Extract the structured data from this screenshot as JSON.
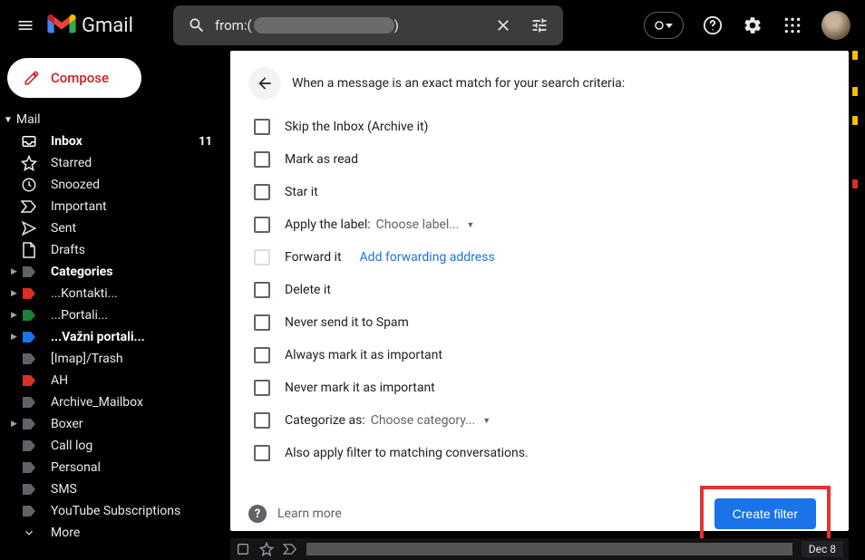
{
  "app": {
    "name": "Gmail"
  },
  "search": {
    "prefix": "from:(",
    "suffix": ")"
  },
  "compose": {
    "label": "Compose"
  },
  "mail_section": {
    "label": "Mail"
  },
  "nav": [
    {
      "label": "Inbox",
      "count": "11",
      "bold": true
    },
    {
      "label": "Starred"
    },
    {
      "label": "Snoozed"
    },
    {
      "label": "Important"
    },
    {
      "label": "Sent"
    },
    {
      "label": "Drafts"
    },
    {
      "label": "Categories",
      "bold": true
    },
    {
      "label": "...Kontakti..."
    },
    {
      "label": "...Portali..."
    },
    {
      "label": "...Važni portali...",
      "bold": true
    },
    {
      "label": "[Imap]/Trash"
    },
    {
      "label": "AH"
    },
    {
      "label": "Archive_Mailbox"
    },
    {
      "label": "Boxer"
    },
    {
      "label": "Call log"
    },
    {
      "label": "Personal"
    },
    {
      "label": "SMS"
    },
    {
      "label": "YouTube Subscriptions"
    },
    {
      "label": "More"
    }
  ],
  "panel": {
    "title": "When a message is an exact match for your search criteria:",
    "options": {
      "skip_inbox": "Skip the Inbox (Archive it)",
      "mark_read": "Mark as read",
      "star": "Star it",
      "apply_label": "Apply the label:",
      "choose_label": "Choose label...",
      "forward": "Forward it",
      "add_forward": "Add forwarding address",
      "delete": "Delete it",
      "never_spam": "Never send it to Spam",
      "always_important": "Always mark it as important",
      "never_important": "Never mark it as important",
      "categorize": "Categorize as:",
      "choose_category": "Choose category...",
      "also_apply": "Also apply filter to matching conversations."
    },
    "learn_more": "Learn more",
    "create_filter": "Create filter"
  },
  "bottom": {
    "date": "Dec 8"
  }
}
